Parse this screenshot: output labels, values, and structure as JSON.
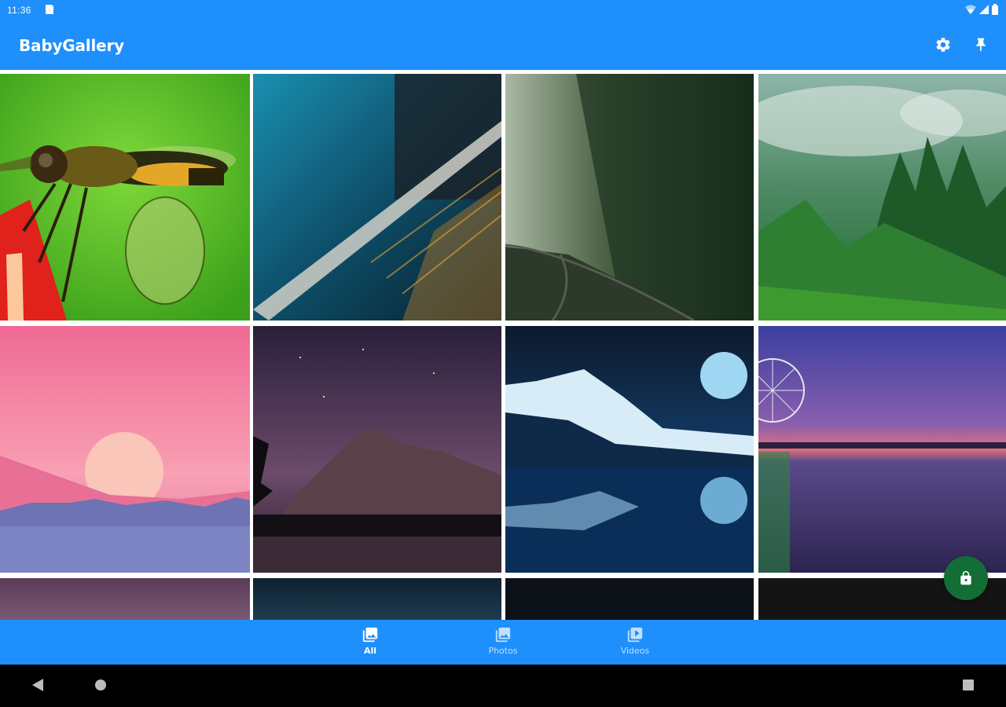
{
  "status_bar": {
    "time": "11:36",
    "icons": [
      "sd-card-icon",
      "wifi-icon",
      "signal-icon",
      "battery-icon"
    ]
  },
  "app_bar": {
    "title": "BabyGallery",
    "actions": [
      "settings-icon",
      "pin-icon"
    ]
  },
  "grid": {
    "columns": 4,
    "tiles": [
      {
        "subject": "dragonfly"
      },
      {
        "subject": "blue-texture"
      },
      {
        "subject": "foggy-railway"
      },
      {
        "subject": "misty-forest"
      },
      {
        "subject": "pink-sunset"
      },
      {
        "subject": "mountain-night"
      },
      {
        "subject": "moon-mountain-lake"
      },
      {
        "subject": "ferris-wheel-lake"
      },
      {
        "subject": "partial-1"
      },
      {
        "subject": "partial-2"
      },
      {
        "subject": "partial-3"
      },
      {
        "subject": "partial-4"
      }
    ]
  },
  "fab": {
    "icon": "lock-icon"
  },
  "bottom_nav": {
    "items": [
      {
        "label": "All",
        "icon": "all-media-icon",
        "active": true
      },
      {
        "label": "Photos",
        "icon": "photos-icon",
        "active": false
      },
      {
        "label": "Videos",
        "icon": "videos-icon",
        "active": false
      }
    ]
  },
  "system_nav": {
    "icons": [
      "back-icon",
      "home-icon",
      "recents-icon"
    ]
  },
  "colors": {
    "primary": "#1f8ffb",
    "fab": "#126e35",
    "nav_inactive": "#bfe0ff",
    "system_bar": "#000000"
  }
}
